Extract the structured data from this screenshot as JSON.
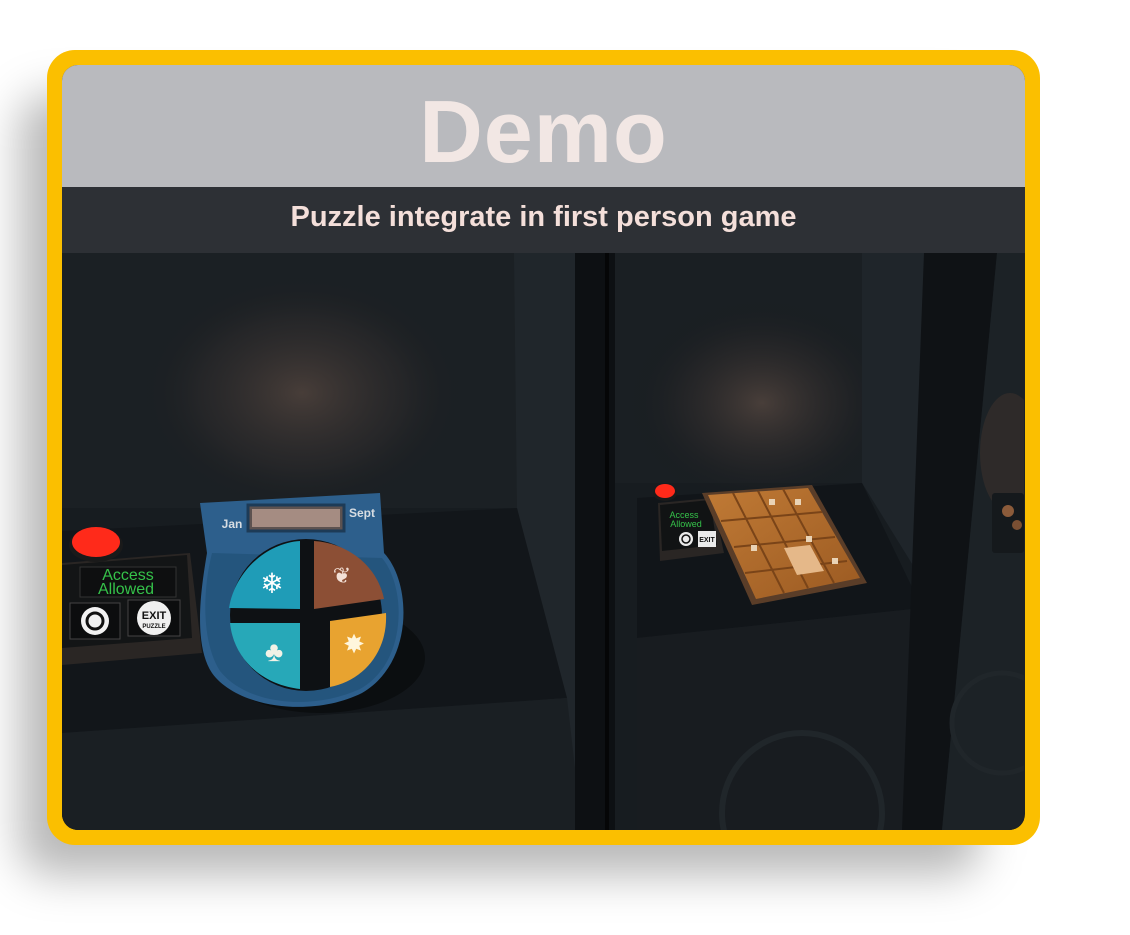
{
  "header": {
    "title": "Demo"
  },
  "subheader": {
    "subtitle": "Puzzle integrate in first person game"
  },
  "scene": {
    "left_booth": {
      "calendar_left_label": "Jan",
      "calendar_right_label": "Sept",
      "panel_status": [
        "Access",
        "Allowed"
      ],
      "exit_button": [
        "EXIT",
        "PUZZLE"
      ]
    },
    "right_booth": {
      "panel_status": [
        "Access",
        "Allowed"
      ],
      "exit_button": "EXIT"
    },
    "colors": {
      "frame": "#fbbf00",
      "title_bar": "#b9babe",
      "subtitle_bar": "#2d3035",
      "season_winter": "#1f9cb7",
      "season_autumn": "#8c4f35",
      "season_spring": "#27a8b8",
      "season_summer": "#e8a330",
      "access_text": "#35c24a",
      "red_button": "#ff2a1a"
    }
  }
}
